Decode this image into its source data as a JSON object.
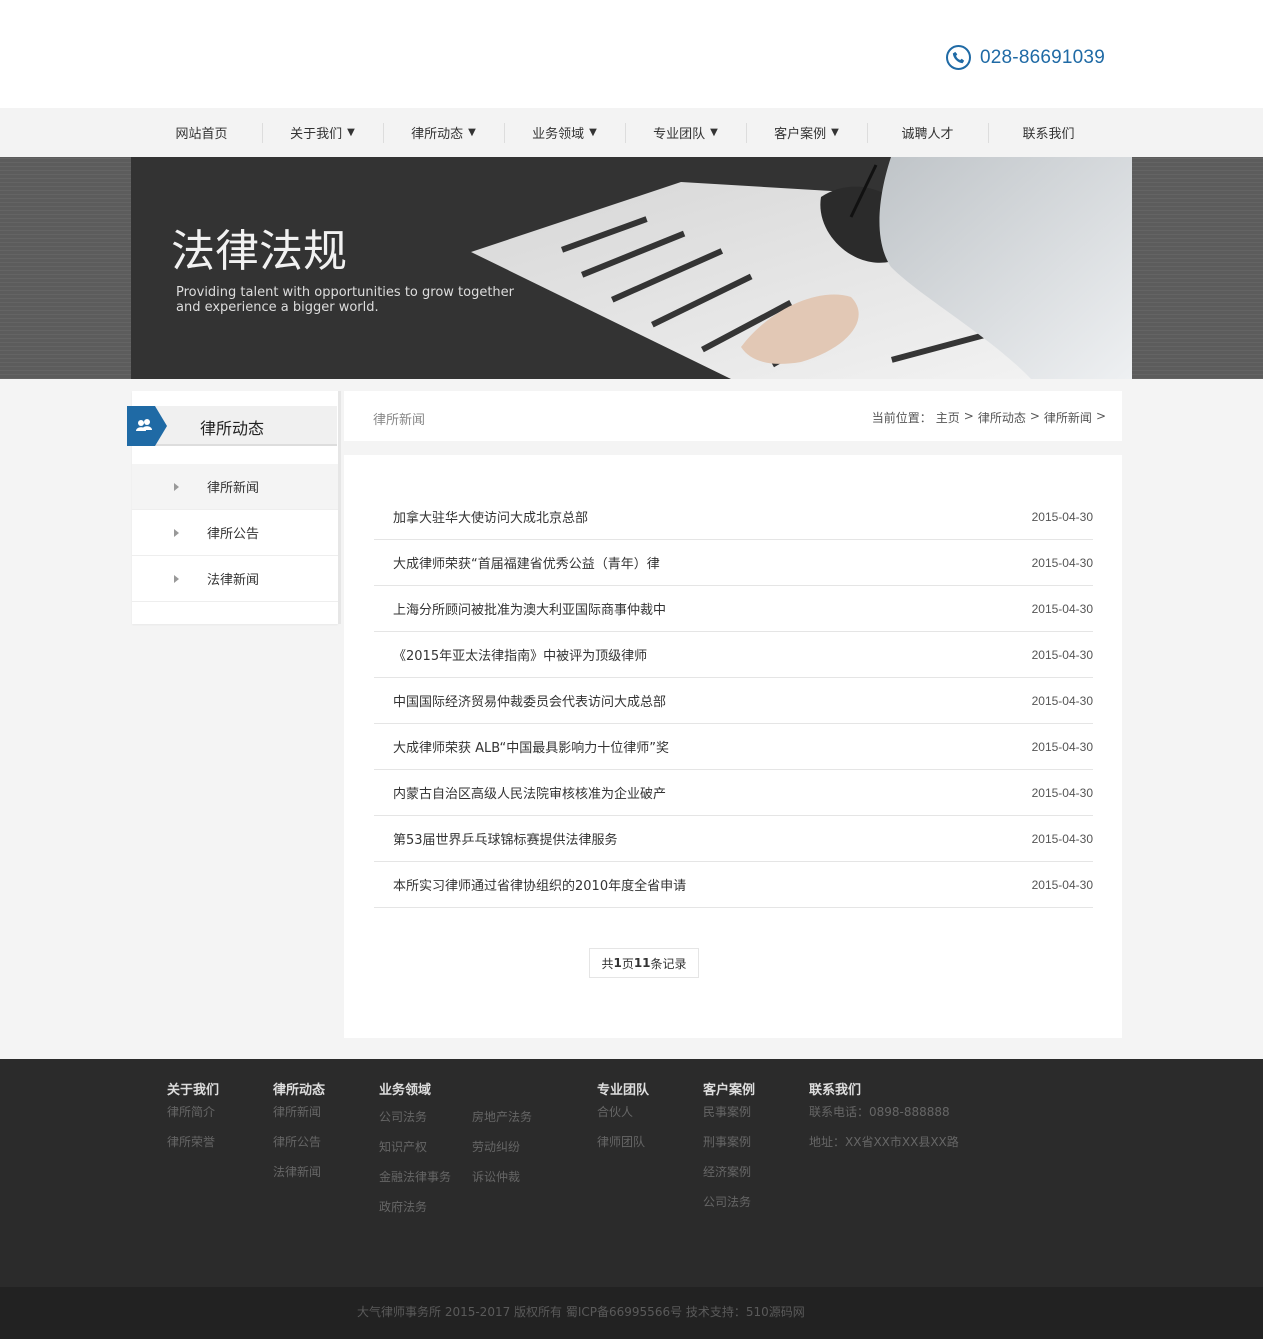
{
  "header": {
    "phone": "028-86691039",
    "accent": "#1f6aa5"
  },
  "nav": {
    "items": [
      {
        "label": "网站首页",
        "dropdown": false
      },
      {
        "label": "关于我们",
        "dropdown": true
      },
      {
        "label": "律所动态",
        "dropdown": true
      },
      {
        "label": "业务领域",
        "dropdown": true
      },
      {
        "label": "专业团队",
        "dropdown": true
      },
      {
        "label": "客户案例",
        "dropdown": true
      },
      {
        "label": "诚聘人才",
        "dropdown": false
      },
      {
        "label": "联系我们",
        "dropdown": false
      }
    ],
    "arrow": "▼"
  },
  "banner": {
    "title": "法律法规",
    "subtitle_line1": "Providing talent with opportunities to grow together",
    "subtitle_line2": "and experience a bigger world."
  },
  "sidebar": {
    "title": "律所动态",
    "items": [
      {
        "label": "律所新闻"
      },
      {
        "label": "律所公告"
      },
      {
        "label": "法律新闻"
      }
    ]
  },
  "breadcrumb": {
    "section_title": "律所新闻",
    "prefix": "当前位置：",
    "path": [
      "主页",
      "律所动态",
      "律所新闻"
    ],
    "sep": ">"
  },
  "news": {
    "rows": [
      {
        "title": "加拿大驻华大使访问大成北京总部",
        "date": "2015-04-30"
      },
      {
        "title": "大成律师荣获“首届福建省优秀公益（青年）律",
        "date": "2015-04-30"
      },
      {
        "title": "上海分所顾问被批准为澳大利亚国际商事仲裁中",
        "date": "2015-04-30"
      },
      {
        "title": "《2015年亚太法律指南》中被评为顶级律师",
        "date": "2015-04-30"
      },
      {
        "title": "中国国际经济贸易仲裁委员会代表访问大成总部",
        "date": "2015-04-30"
      },
      {
        "title": "大成律师荣获 ALB“中国最具影响力十位律师”奖",
        "date": "2015-04-30"
      },
      {
        "title": "内蒙古自治区高级人民法院审核核准为企业破产",
        "date": "2015-04-30"
      },
      {
        "title": "第53届世界乒乓球锦标赛提供法律服务",
        "date": "2015-04-30"
      },
      {
        "title": "本所实习律师通过省律协组织的2010年度全省申请",
        "date": "2015-04-30"
      }
    ],
    "pager": {
      "prefix": "共 ",
      "pages": "1",
      "mid": "页",
      "count": "11",
      "suffix": "条记录"
    }
  },
  "footer": {
    "about": {
      "heading": "关于我们",
      "links": [
        "律所简介",
        "律所荣誉"
      ]
    },
    "news": {
      "heading": "律所动态",
      "links": [
        "律所新闻",
        "律所公告",
        "法律新闻"
      ]
    },
    "practice": {
      "heading": "业务领域",
      "links": [
        "公司法务",
        "房地产法务",
        "知识产权",
        "劳动纠纷",
        "金融法律事务",
        "诉讼仲裁",
        "政府法务"
      ]
    },
    "team": {
      "heading": "专业团队",
      "links": [
        "合伙人",
        "律师团队"
      ]
    },
    "cases": {
      "heading": "客户案例",
      "links": [
        "民事案例",
        "刑事案例",
        "经济案例",
        "公司法务"
      ]
    },
    "contact": {
      "heading": "联系我们",
      "phone": "联系电话：0898-888888",
      "address": "地址：XX省XX市XX县XX路"
    }
  },
  "copyright": "大气律师事务所 2015-2017 版权所有 蜀ICP备66995566号 技术支持：510源码网"
}
